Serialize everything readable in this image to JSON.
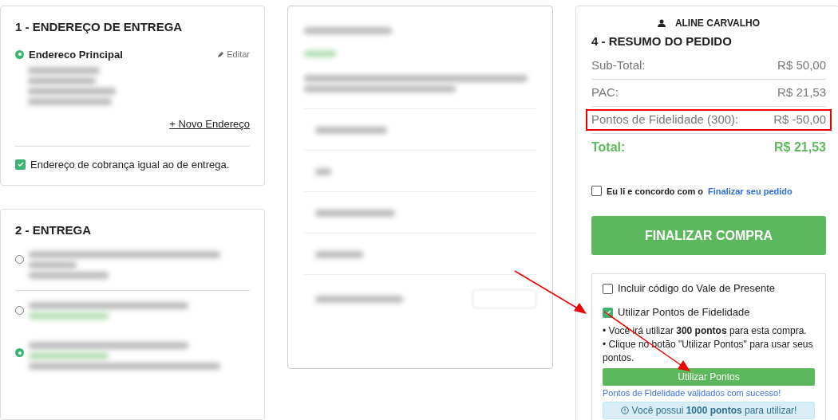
{
  "address": {
    "title": "1 - ENDEREÇO DE ENTREGA",
    "name": "Endereco Principal",
    "selected": true,
    "edit": "Editar",
    "new_address": "+ Novo Endereço",
    "billing_same": {
      "label": "Endereço de cobrança igual ao de entrega.",
      "checked": true
    }
  },
  "shipping": {
    "title": "2 - ENTREGA",
    "options": [
      {
        "selected": false
      },
      {
        "selected": false
      },
      {
        "selected": true
      }
    ]
  },
  "summary": {
    "customer": "ALINE CARVALHO",
    "title": "4 - RESUMO DO PEDIDO",
    "rows": [
      {
        "label": "Sub-Total:",
        "value": "R$ 50,00",
        "highlighted": false
      },
      {
        "label": "PAC:",
        "value": "R$ 21,53",
        "highlighted": false
      },
      {
        "label": "Pontos de Fidelidade (300):",
        "value": "R$ -50,00",
        "highlighted": true
      }
    ],
    "total": {
      "label": "Total:",
      "value": "R$ 21,53"
    },
    "terms": {
      "text": "Eu li e concordo com o",
      "link": "Finalizar seu pedido",
      "checked": false
    },
    "finish_button": "FINALIZAR COMPRA",
    "extras": {
      "options": [
        {
          "label": "Incluir código do Vale de Presente",
          "checked": false
        },
        {
          "label": "Utilizar Pontos de Fidelidade",
          "checked": true
        }
      ],
      "notes": [
        "• Você irá utilizar **300 pontos** para esta compra.",
        "• Clique no botão \"Utilizar Pontos\" para usar seus pontos."
      ],
      "button": "Utilizar Pontos",
      "success": "Pontos de Fidelidade validados com sucesso!",
      "info": "Você possui **1000 pontos** para utilizar!"
    }
  }
}
